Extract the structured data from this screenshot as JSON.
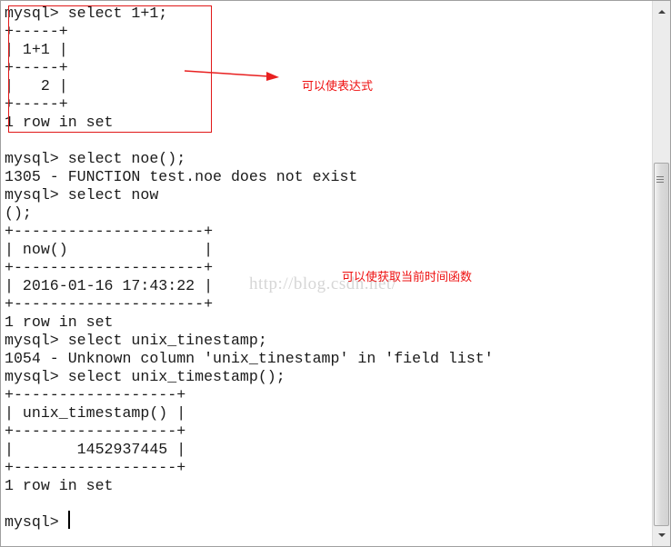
{
  "terminal": {
    "lines": [
      "mysql> select 1+1;",
      "+-----+",
      "| 1+1 |",
      "+-----+",
      "|   2 |",
      "+-----+",
      "1 row in set",
      "",
      "mysql> select noe();",
      "1305 - FUNCTION test.noe does not exist",
      "mysql> select now",
      "();",
      "+---------------------+",
      "| now()               |",
      "+---------------------+",
      "| 2016-01-16 17:43:22 |",
      "+---------------------+",
      "1 row in set",
      "mysql> select unix_tinestamp;",
      "1054 - Unknown column 'unix_tinestamp' in 'field list'",
      "mysql> select unix_timestamp();",
      "+------------------+",
      "| unix_timestamp() |",
      "+------------------+",
      "|       1452937445 |",
      "+------------------+",
      "1 row in set",
      "",
      "mysql> "
    ]
  },
  "annotations": {
    "expression_note": "可以使表达式",
    "time_function_note": "可以使获取当前时间函数",
    "color": "#ee1010"
  },
  "watermark": "http://blog.csdn.net/",
  "scrollbar": {
    "up_icon": "triangle-up",
    "down_icon": "triangle-down",
    "grip_icon": "three-lines"
  }
}
